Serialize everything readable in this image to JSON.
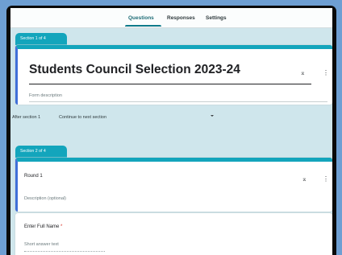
{
  "tabs": [
    {
      "label": "Questions",
      "active": true
    },
    {
      "label": "Responses",
      "active": false
    },
    {
      "label": "Settings",
      "active": false
    }
  ],
  "section1": {
    "tab_label": "Section 1 of 4",
    "title": "Students Council Selection 2023-24",
    "description_placeholder": "Form description"
  },
  "after_section": {
    "label": "After section 1",
    "value": "Continue to next section"
  },
  "section2": {
    "tab_label": "Section 2 of 4",
    "title": "Round 1",
    "description_placeholder": "Description (optional)"
  },
  "question": {
    "label": "Enter Full Name",
    "required_mark": "*",
    "answer_placeholder": "Short answer text"
  },
  "icons": {
    "collapse": "⌅",
    "more": "⋮"
  },
  "colors": {
    "accent": "#13a5bc",
    "focus_border": "#3f6fd8",
    "background": "#cfe6ec"
  }
}
